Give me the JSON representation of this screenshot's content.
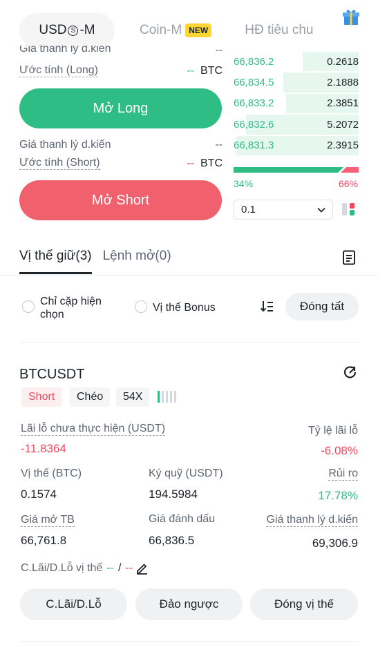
{
  "tabs": {
    "usds_prefix": "USD",
    "usds_symbol": "S",
    "usds_suffix": "-M",
    "coin_m": "Coin-M",
    "new_badge": "NEW",
    "hd": "HĐ tiêu chu"
  },
  "order_form": {
    "liq_label_top": "Giá thanh lý d.kiến",
    "liq_value_top": "--",
    "estimate_long_label": "Ước tính (Long)",
    "estimate_long_dash": "--",
    "estimate_long_unit": "BTC",
    "open_long": "Mở Long",
    "liq_label": "Giá thanh lý d.kiến",
    "liq_value": "--",
    "estimate_short_label": "Ước tính (Short)",
    "estimate_short_dash": "--",
    "estimate_short_unit": "BTC",
    "open_short": "Mở Short"
  },
  "order_book": {
    "rows": [
      {
        "price": "66,836.2",
        "qty": "0.2618",
        "depth": 0.45
      },
      {
        "price": "66,834.5",
        "qty": "2.1888",
        "depth": 0.6
      },
      {
        "price": "66,833.2",
        "qty": "2.3851",
        "depth": 0.58
      },
      {
        "price": "66,832.6",
        "qty": "5.2072",
        "depth": 0.9
      },
      {
        "price": "66,831.3",
        "qty": "2.3915",
        "depth": 0.98
      }
    ],
    "buy_pct": "34%",
    "sell_pct": "66%",
    "buy_ratio": 0.34,
    "precision": "0.1"
  },
  "positions_tabs": {
    "holding": "Vị thế giữ(3)",
    "open_orders": "Lệnh mở(0)"
  },
  "filters": {
    "current_pair": "Chỉ cặp hiện chọn",
    "bonus": "Vị thế Bonus",
    "close_all": "Đóng tất"
  },
  "position": {
    "symbol": "BTCUSDT",
    "side": "Short",
    "margin_mode": "Chéo",
    "leverage": "54X",
    "unrealized_label": "Lãi lỗ chưa thực hiện (USDT)",
    "unrealized_value": "-11.8364",
    "roe_label": "Tỷ lệ lãi lỗ",
    "roe_value": "-6.08%",
    "size_label": "Vị thế (BTC)",
    "size_value": "0.1574",
    "margin_label": "Ký quỹ (USDT)",
    "margin_value": "194.5984",
    "risk_label": "Rủi ro",
    "risk_value": "17.78%",
    "entry_label": "Giá mở TB",
    "entry_value": "66,761.8",
    "mark_label": "Giá đánh dấu",
    "mark_value": "66,836.5",
    "liq_label": "Giá thanh lý d.kiến",
    "liq_value": "69,306.9",
    "tpsl_label": "C.Lãi/D.Lỗ vị thế",
    "tpsl_tp": "--",
    "tpsl_sep": "/",
    "tpsl_sl": "--"
  },
  "actions": {
    "tpsl": "C.Lãi/D.Lỗ",
    "reverse": "Đảo ngược",
    "close": "Đóng vị thế"
  },
  "colors": {
    "green": "#2ebd85",
    "red": "#f6465d",
    "accent_yellow": "#fcd535"
  }
}
